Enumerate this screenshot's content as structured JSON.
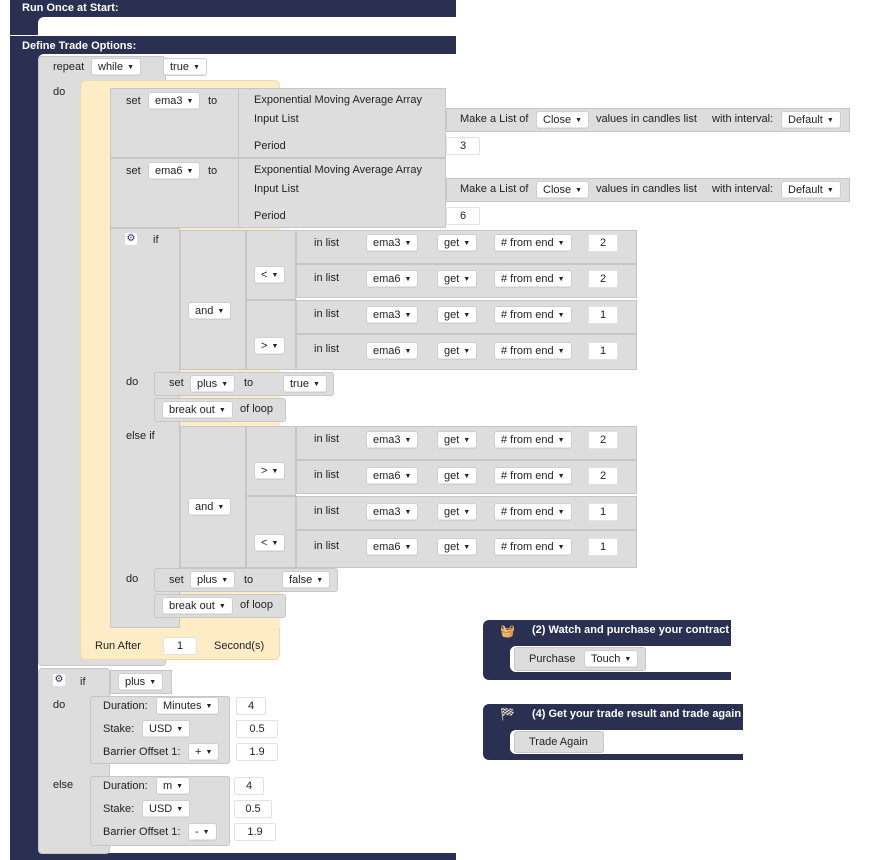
{
  "run_once": {
    "title": "Run Once at Start:"
  },
  "define": {
    "title": "Define Trade Options:"
  },
  "repeat": {
    "label": "repeat",
    "mode": "while",
    "cond": "true",
    "do": "do"
  },
  "set_ema3": {
    "set": "set",
    "var": "ema3",
    "to": "to",
    "func": "Exponential Moving Average Array",
    "input_list": "Input List",
    "make_list": "Make a List of",
    "field": "Close",
    "values_in": "values in candles list",
    "with_interval": "with interval:",
    "interval": "Default",
    "period_label": "Period",
    "period": "3"
  },
  "set_ema6": {
    "set": "set",
    "var": "ema6",
    "to": "to",
    "func": "Exponential Moving Average Array",
    "input_list": "Input List",
    "make_list": "Make a List of",
    "field": "Close",
    "values_in": "values in candles list",
    "with_interval": "with interval:",
    "interval": "Default",
    "period_label": "Period",
    "period": "6"
  },
  "cond_if": {
    "if": "if",
    "logic": "and",
    "cmp1": "<",
    "cmp2": ">",
    "rows": [
      {
        "in_list": "in list",
        "var": "ema3",
        "get": "get",
        "from": "# from end",
        "n": "2"
      },
      {
        "in_list": "in list",
        "var": "ema6",
        "get": "get",
        "from": "# from end",
        "n": "2"
      },
      {
        "in_list": "in list",
        "var": "ema3",
        "get": "get",
        "from": "# from end",
        "n": "1"
      },
      {
        "in_list": "in list",
        "var": "ema6",
        "get": "get",
        "from": "# from end",
        "n": "1"
      }
    ],
    "do": "do",
    "set": "set",
    "var": "plus",
    "to": "to",
    "val": "true",
    "break": "break out",
    "of_loop": "of loop"
  },
  "cond_elseif": {
    "elseif": "else if",
    "logic": "and",
    "cmp1": ">",
    "cmp2": "<",
    "rows": [
      {
        "in_list": "in list",
        "var": "ema3",
        "get": "get",
        "from": "# from end",
        "n": "2"
      },
      {
        "in_list": "in list",
        "var": "ema6",
        "get": "get",
        "from": "# from end",
        "n": "2"
      },
      {
        "in_list": "in list",
        "var": "ema3",
        "get": "get",
        "from": "# from end",
        "n": "1"
      },
      {
        "in_list": "in list",
        "var": "ema6",
        "get": "get",
        "from": "# from end",
        "n": "1"
      }
    ],
    "do": "do",
    "set": "set",
    "var": "plus",
    "to": "to",
    "val": "false",
    "break": "break out",
    "of_loop": "of loop"
  },
  "run_after": {
    "label": "Run After",
    "value": "1",
    "unit": "Second(s)"
  },
  "trade_if": {
    "if": "if",
    "var": "plus",
    "do": "do",
    "else": "else",
    "do_block": {
      "duration": "Duration:",
      "duration_unit": "Minutes",
      "duration_val": "4",
      "stake": "Stake:",
      "currency": "USD",
      "stake_val": "0.5",
      "barrier": "Barrier Offset 1:",
      "sign": "+",
      "barrier_val": "1.9"
    },
    "else_block": {
      "duration": "Duration:",
      "duration_unit": "m",
      "duration_val": "4",
      "stake": "Stake:",
      "currency": "USD",
      "stake_val": "0.5",
      "barrier": "Barrier Offset 1:",
      "sign": "-",
      "barrier_val": "1.9"
    }
  },
  "watch": {
    "title": "(2) Watch and purchase your contract",
    "purchase": "Purchase",
    "type": "Touch"
  },
  "result": {
    "title": "(4) Get your trade result and trade again",
    "trade_again": "Trade Again"
  },
  "colors": {
    "navy": "#2a3052",
    "gray": "#dddddd",
    "cream": "#fdecc6"
  },
  "icons": {
    "gear": "gear-icon",
    "basket": "basket-icon",
    "flag": "checkered-flag-icon"
  }
}
